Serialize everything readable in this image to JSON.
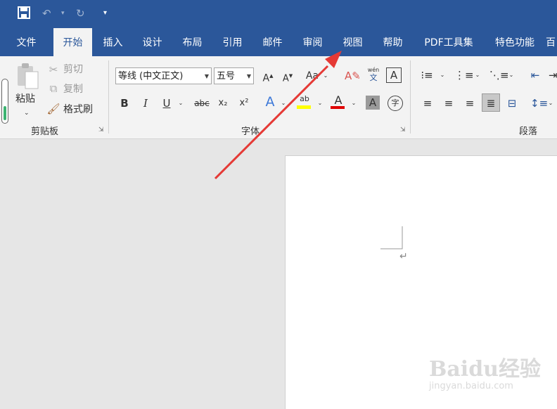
{
  "tabs": [
    "文件",
    "开始",
    "插入",
    "设计",
    "布局",
    "引用",
    "邮件",
    "审阅",
    "视图",
    "帮助",
    "PDF工具集",
    "特色功能",
    "百"
  ],
  "clipboard": {
    "paste": "粘贴",
    "cut": "剪切",
    "copy": "复制",
    "format_painter": "格式刷",
    "group": "剪贴板"
  },
  "font": {
    "name": "等线 (中文正文)",
    "size": "五号",
    "group": "字体",
    "bold": "B",
    "italic": "I",
    "underline": "U",
    "strike": "abc",
    "subscript": "x₂",
    "superscript": "x²",
    "aa": "Aa",
    "pinyin_top": "wén",
    "pinyin_bottom": "文",
    "boxed": "A",
    "color_a": "A",
    "shade_a": "A",
    "circle": "字",
    "hl": "ab"
  },
  "paragraph": {
    "group": "段落"
  },
  "watermark": {
    "brand": "Baidu经验",
    "url": "jingyan.baidu.com"
  },
  "colors": {
    "brand": "#2b579a",
    "highlight": "#ffff00",
    "font_red": "#e00000",
    "arrow": "#e53935"
  }
}
